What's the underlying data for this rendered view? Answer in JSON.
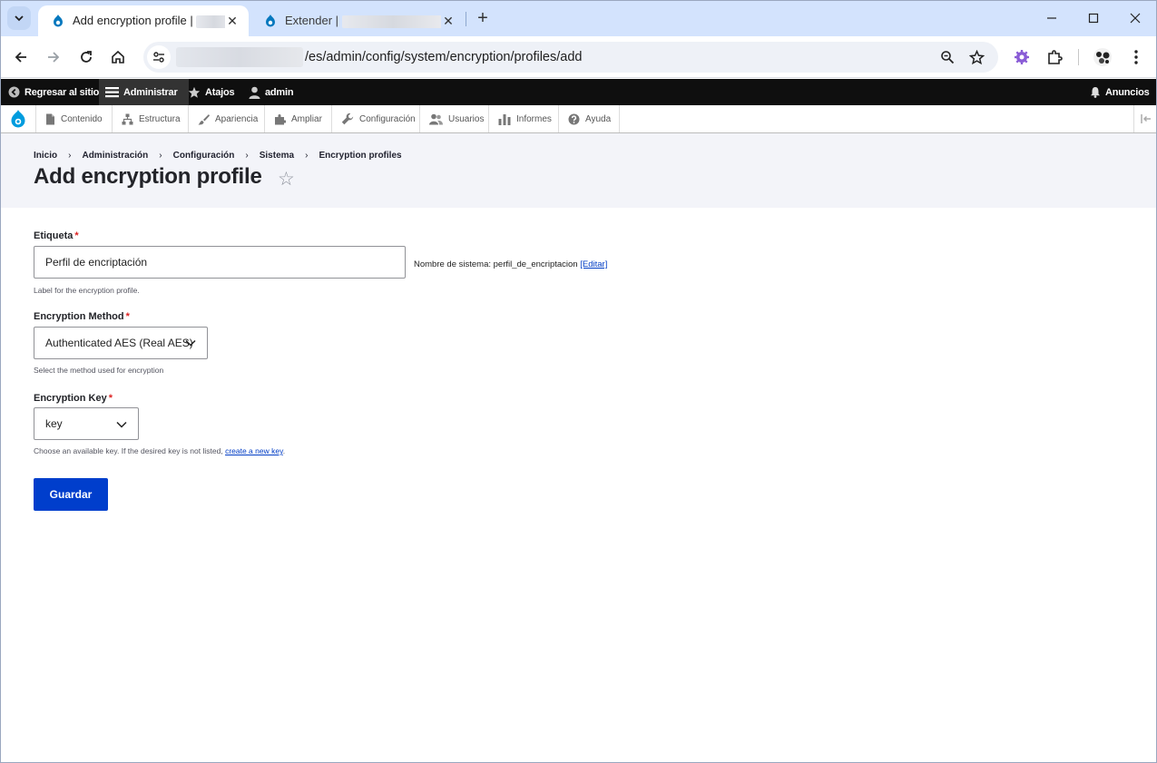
{
  "browser": {
    "tabs": [
      {
        "label": "Add encryption profile |",
        "active": true
      },
      {
        "label": "Extender |",
        "active": false
      }
    ],
    "url": "/es/admin/config/system/encryption/profiles/add",
    "accent": "#d3e3fd"
  },
  "toolbar": {
    "back_label": "Regresar al sitio",
    "admin_label": "Administrar",
    "shortcuts_label": "Atajos",
    "user_label": "admin",
    "announcements_label": "Anuncios"
  },
  "tray": {
    "items": [
      {
        "label": "Contenido",
        "icon": "page-icon"
      },
      {
        "label": "Estructura",
        "icon": "structure-icon"
      },
      {
        "label": "Apariencia",
        "icon": "brush-icon"
      },
      {
        "label": "Ampliar",
        "icon": "puzzle-icon"
      },
      {
        "label": "Configuración",
        "icon": "wrench-icon"
      },
      {
        "label": "Usuarios",
        "icon": "users-icon"
      },
      {
        "label": "Informes",
        "icon": "bar-chart-icon"
      },
      {
        "label": "Ayuda",
        "icon": "help-icon"
      }
    ]
  },
  "breadcrumb": [
    "Inicio",
    "Administración",
    "Configuración",
    "Sistema",
    "Encryption profiles"
  ],
  "page_title": "Add encryption profile",
  "form": {
    "label_field": {
      "label": "Etiqueta",
      "value": "Perfil de encriptación",
      "machine_prefix": "Nombre de sistema: perfil_de_encriptacion",
      "machine_edit": "[Editar]",
      "description": "Label for the encryption profile."
    },
    "method_field": {
      "label": "Encryption Method",
      "value": "Authenticated AES (Real AES)",
      "description": "Select the method used for encryption"
    },
    "key_field": {
      "label": "Encryption Key",
      "value": "key",
      "description_prefix": "Choose an available key. If the desired key is not listed,",
      "description_link": "create a new key",
      "description_suffix": "."
    },
    "required_marker": "*",
    "submit_label": "Guardar",
    "primary_color": "#003ecc"
  }
}
